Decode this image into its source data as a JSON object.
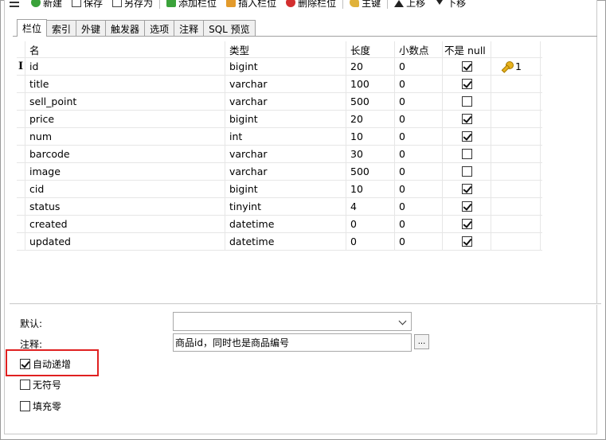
{
  "toolbar": {
    "items": [
      {
        "label": "",
        "icon": "menu-icon"
      },
      {
        "label": "新建",
        "icon": "new-icon"
      },
      {
        "label": "保存",
        "icon": "save-icon"
      },
      {
        "label": "另存为",
        "icon": "save-as-icon"
      },
      {
        "label": "添加栏位",
        "icon": "add-column-icon"
      },
      {
        "label": "插入栏位",
        "icon": "insert-column-icon"
      },
      {
        "label": "删除栏位",
        "icon": "delete-column-icon"
      },
      {
        "label": "主键",
        "icon": "key-icon"
      },
      {
        "label": "上移",
        "icon": "move-up-icon"
      },
      {
        "label": "下移",
        "icon": "move-down-icon"
      }
    ]
  },
  "tabs": [
    {
      "label": "栏位",
      "active": true
    },
    {
      "label": "索引",
      "active": false
    },
    {
      "label": "外键",
      "active": false
    },
    {
      "label": "触发器",
      "active": false
    },
    {
      "label": "选项",
      "active": false
    },
    {
      "label": "注释",
      "active": false
    },
    {
      "label": "SQL 预览",
      "active": false
    }
  ],
  "grid": {
    "headers": {
      "name": "名",
      "type": "类型",
      "length": "长度",
      "decimals": "小数点",
      "not_null": "不是 null",
      "key": ""
    },
    "current_row_marker": "I",
    "rows": [
      {
        "name": "id",
        "type": "bigint",
        "length": "20",
        "decimals": "0",
        "not_null": true,
        "key": "1"
      },
      {
        "name": "title",
        "type": "varchar",
        "length": "100",
        "decimals": "0",
        "not_null": true,
        "key": ""
      },
      {
        "name": "sell_point",
        "type": "varchar",
        "length": "500",
        "decimals": "0",
        "not_null": false,
        "key": ""
      },
      {
        "name": "price",
        "type": "bigint",
        "length": "20",
        "decimals": "0",
        "not_null": true,
        "key": ""
      },
      {
        "name": "num",
        "type": "int",
        "length": "10",
        "decimals": "0",
        "not_null": true,
        "key": ""
      },
      {
        "name": "barcode",
        "type": "varchar",
        "length": "30",
        "decimals": "0",
        "not_null": false,
        "key": ""
      },
      {
        "name": "image",
        "type": "varchar",
        "length": "500",
        "decimals": "0",
        "not_null": false,
        "key": ""
      },
      {
        "name": "cid",
        "type": "bigint",
        "length": "10",
        "decimals": "0",
        "not_null": true,
        "key": ""
      },
      {
        "name": "status",
        "type": "tinyint",
        "length": "4",
        "decimals": "0",
        "not_null": true,
        "key": ""
      },
      {
        "name": "created",
        "type": "datetime",
        "length": "0",
        "decimals": "0",
        "not_null": true,
        "key": ""
      },
      {
        "name": "updated",
        "type": "datetime",
        "length": "0",
        "decimals": "0",
        "not_null": true,
        "key": ""
      }
    ]
  },
  "properties": {
    "default_label": "默认:",
    "default_value": "",
    "comment_label": "注释:",
    "comment_value": "商品id，同时也是商品编号",
    "ellipsis_label": "...",
    "auto_increment_label": "自动递增",
    "auto_increment": true,
    "unsigned_label": "无符号",
    "unsigned": false,
    "zerofill_label": "填充零",
    "zerofill": false
  },
  "colors": {
    "highlight_border": "#e02020",
    "key_icon": "#e8b21e"
  }
}
